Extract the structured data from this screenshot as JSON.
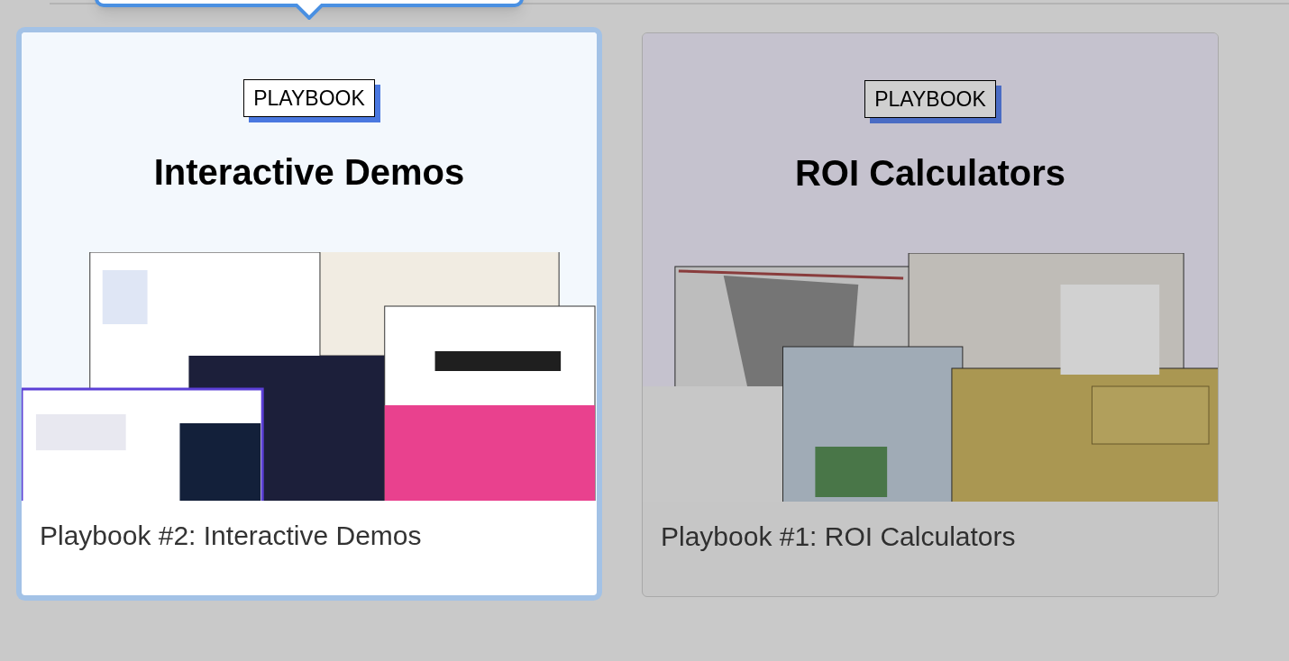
{
  "cards": [
    {
      "badge": "PLAYBOOK",
      "headline": "Interactive Demos",
      "caption": "Playbook #2: Interactive Demos",
      "selected": true
    },
    {
      "badge": "PLAYBOOK",
      "headline": "ROI Calculators",
      "caption": "Playbook #1: ROI Calculators",
      "selected": false
    }
  ]
}
